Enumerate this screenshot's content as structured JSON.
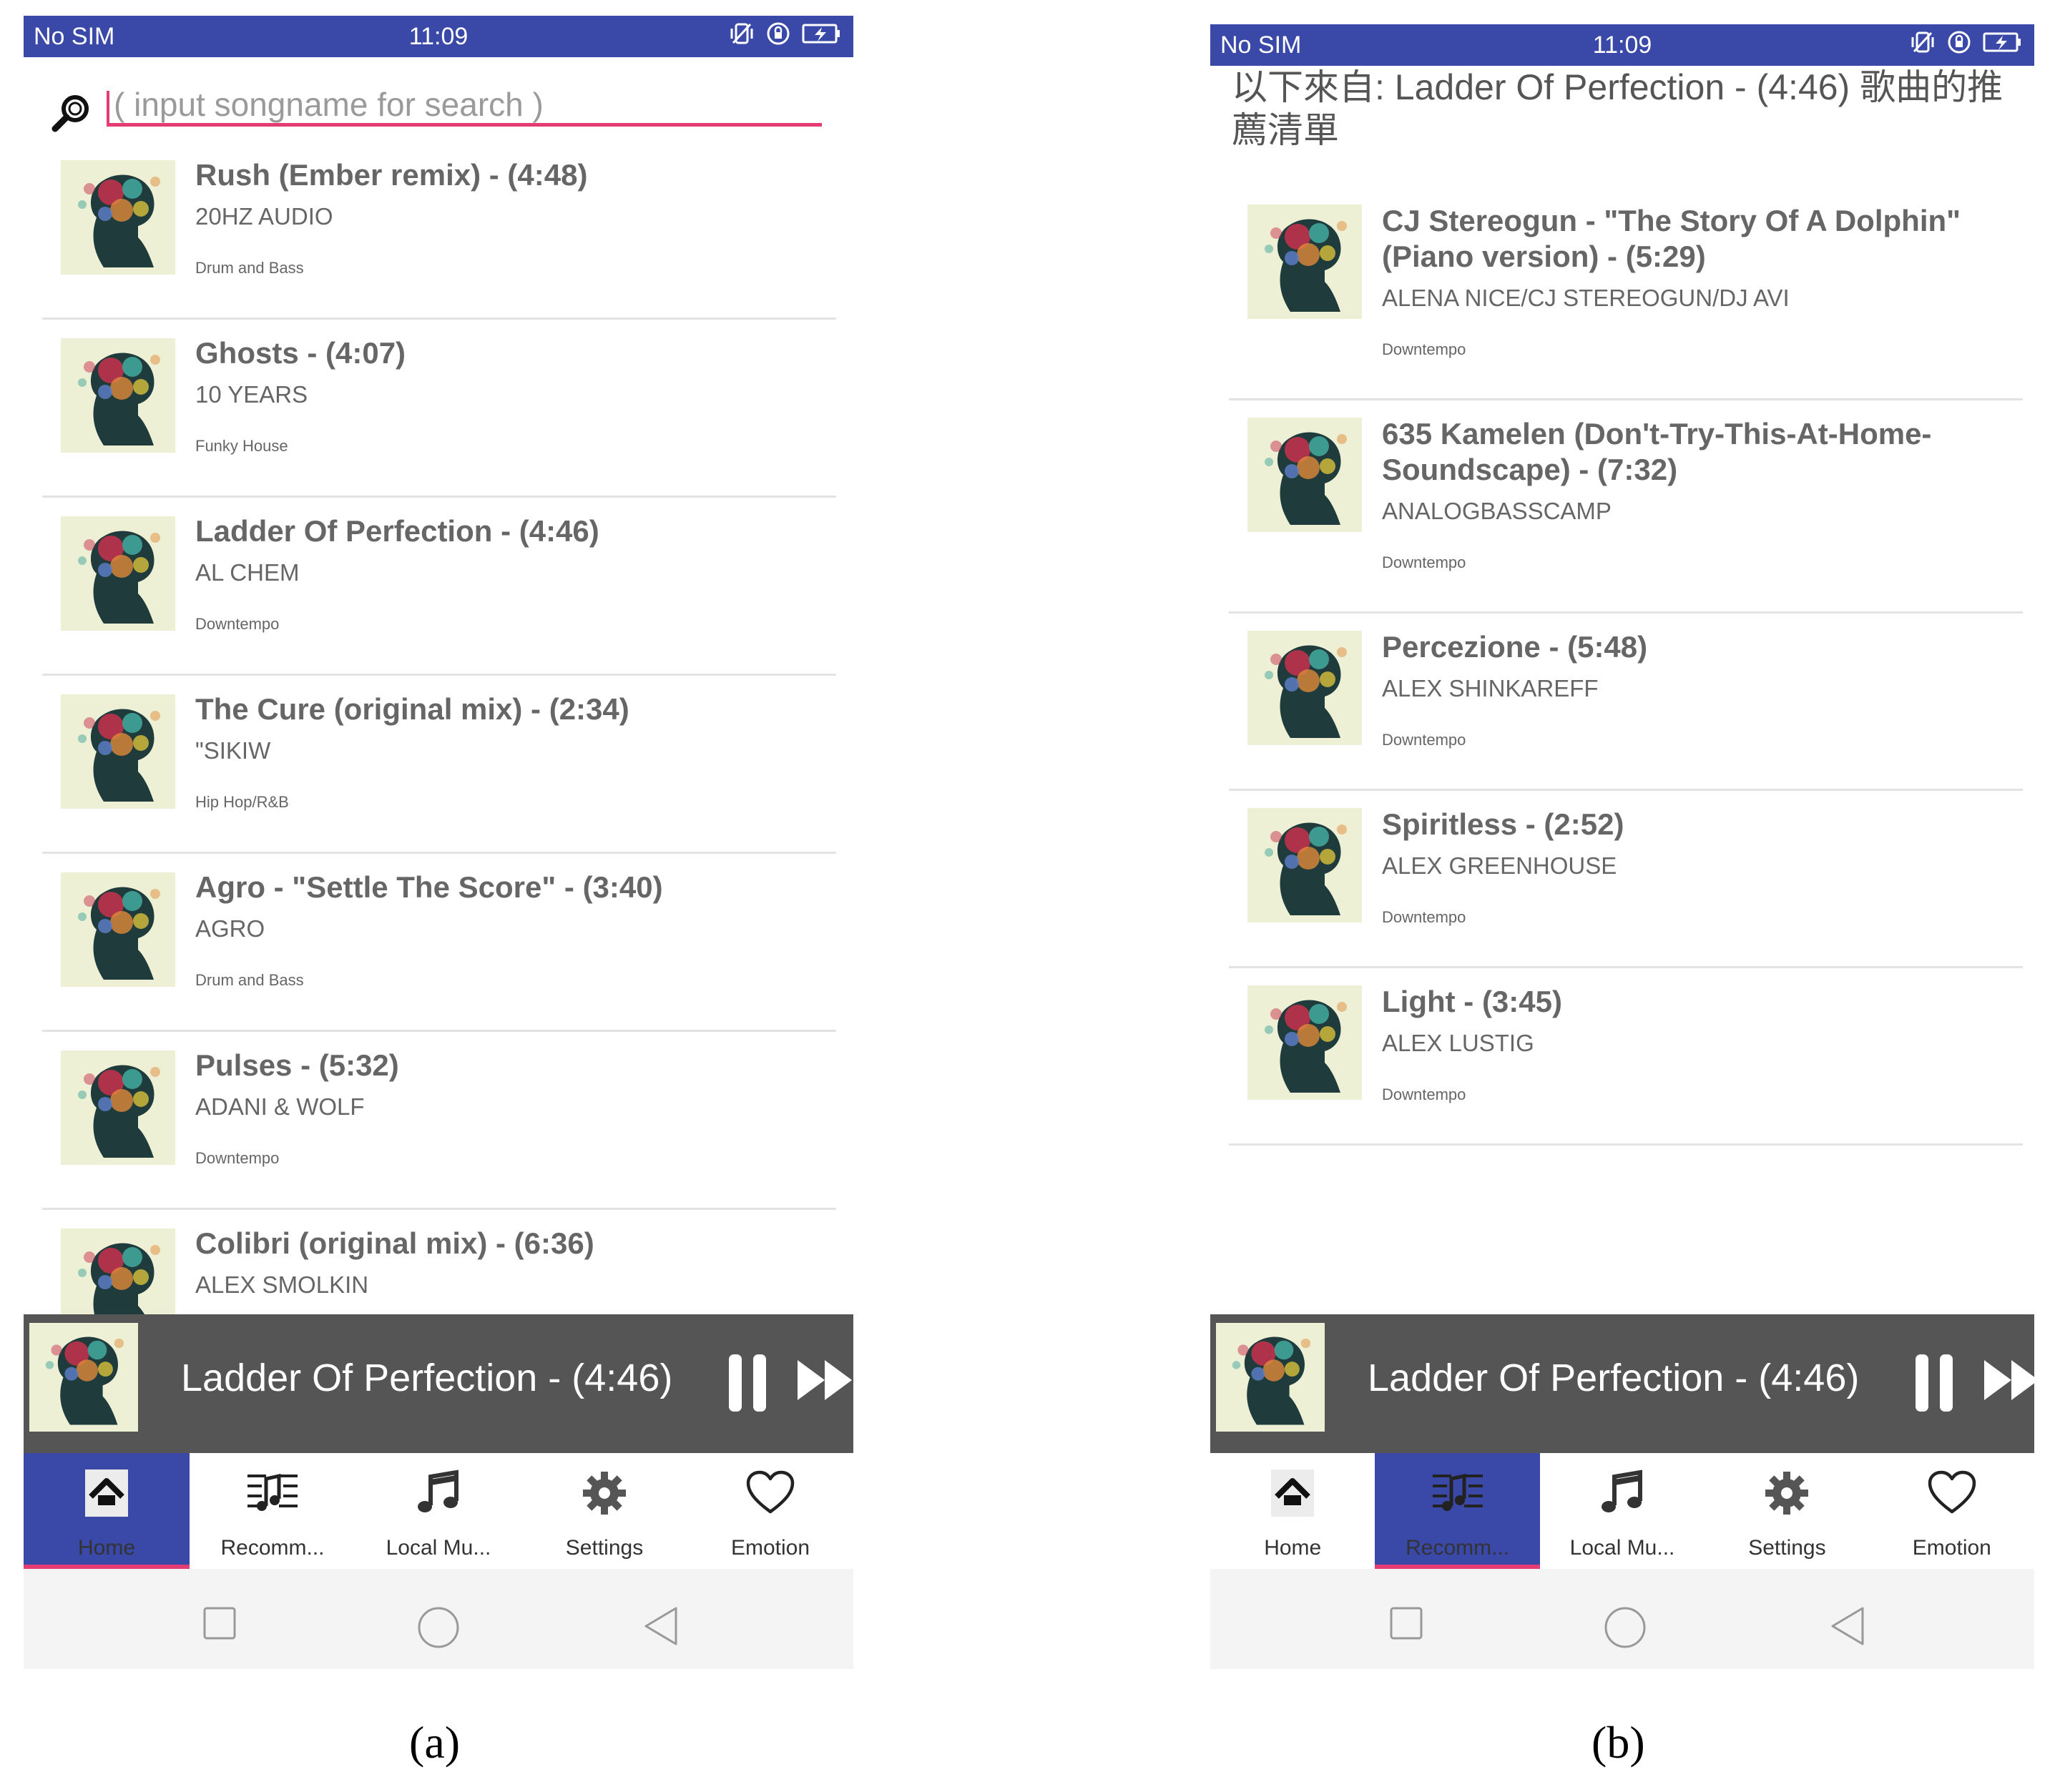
{
  "status_bar": {
    "carrier": "No SIM",
    "time": "11:09"
  },
  "screen_a": {
    "search_placeholder": "( input songname for search )",
    "songs": [
      {
        "title": "Rush (Ember remix) - (4:48)",
        "artist": "20HZ AUDIO",
        "genre": "Drum and Bass"
      },
      {
        "title": "Ghosts - (4:07)",
        "artist": "10 YEARS",
        "genre": "Funky House"
      },
      {
        "title": "Ladder Of Perfection - (4:46)",
        "artist": "AL CHEM",
        "genre": "Downtempo"
      },
      {
        "title": "The Cure (original mix) - (2:34)",
        "artist": "\"SIKIW",
        "genre": "Hip Hop/R&B"
      },
      {
        "title": "Agro - \"Settle The Score\" - (3:40)",
        "artist": "AGRO",
        "genre": "Drum and Bass"
      },
      {
        "title": "Pulses - (5:32)",
        "artist": "ADANI & WOLF",
        "genre": "Downtempo"
      },
      {
        "title": "Colibri (original mix) - (6:36)",
        "artist": "ALEX SMOLKIN",
        "genre": ""
      }
    ],
    "caption": "(a)"
  },
  "screen_b": {
    "heading": "以下來自: Ladder Of Perfection - (4:46) 歌曲的推薦清單",
    "songs": [
      {
        "title": "CJ Stereogun - \"The Story Of A Dolphin\" (Piano version) - (5:29)",
        "artist": "ALENA NICE/CJ STEREOGUN/DJ AVI",
        "genre": "Downtempo"
      },
      {
        "title": "635 Kamelen (Don't-Try-This-At-Home-Soundscape) - (7:32)",
        "artist": "ANALOGBASSCAMP",
        "genre": "Downtempo"
      },
      {
        "title": "Percezione - (5:48)",
        "artist": "ALEX SHINKAREFF",
        "genre": "Downtempo"
      },
      {
        "title": "Spiritless - (2:52)",
        "artist": "ALEX GREENHOUSE",
        "genre": "Downtempo"
      },
      {
        "title": "Light - (3:45)",
        "artist": "ALEX LUSTIG",
        "genre": "Downtempo"
      }
    ],
    "caption": "(b)"
  },
  "now_playing": {
    "title": "Ladder Of Perfection - (4:46)"
  },
  "nav_tabs": [
    "Home",
    "Recomm...",
    "Local Mu...",
    "Settings",
    "Emotion"
  ],
  "nav_icons": [
    "home-icon",
    "recommend-icon",
    "music-note-icon",
    "gear-icon",
    "heart-icon"
  ],
  "colors": {
    "primary": "#3a48a8",
    "accent": "#e33c73",
    "player_bg": "#555555"
  }
}
